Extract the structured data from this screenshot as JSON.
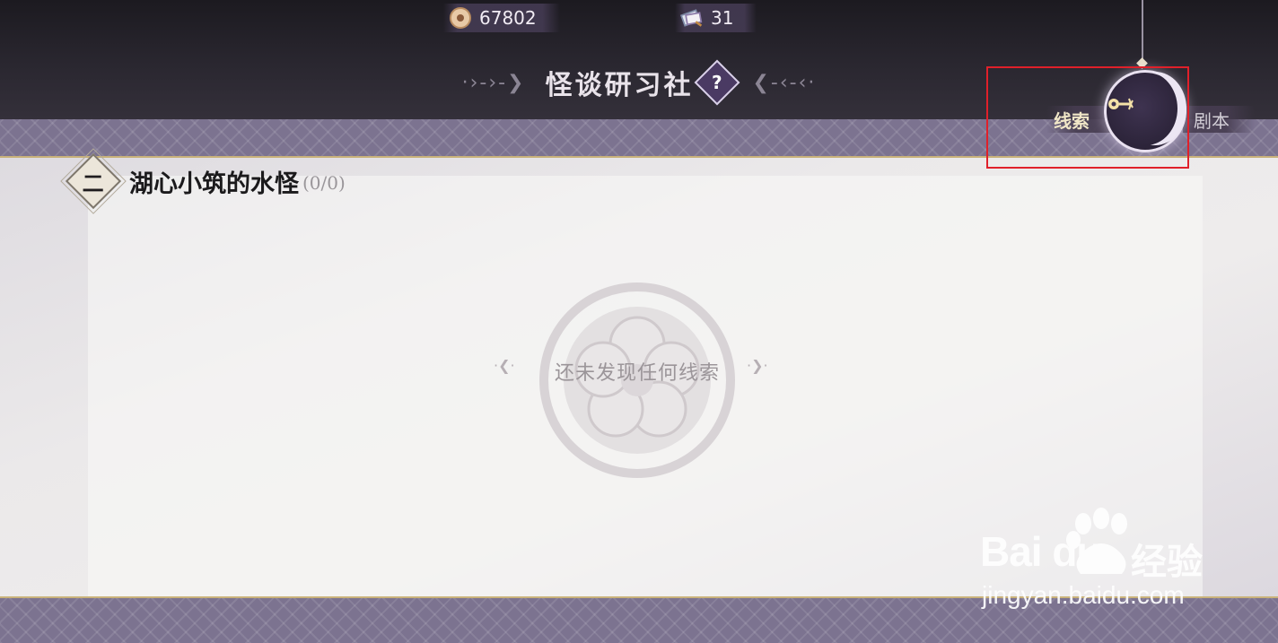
{
  "header": {
    "title": "怪谈研习社",
    "help_label": "?",
    "currencies": [
      {
        "icon": "coin-icon",
        "value": "67802"
      },
      {
        "icon": "scroll-ticket-icon",
        "value": "31"
      }
    ]
  },
  "chapter": {
    "number": "二",
    "title": "湖心小筑的水怪",
    "count": "(0/0)"
  },
  "empty_state": {
    "message": "还未发现任何线索"
  },
  "toggle": {
    "left_label": "线索",
    "right_label": "剧本",
    "selected": "线索"
  },
  "watermark": {
    "logo": "Bai du",
    "brand": "经验",
    "url": "jingyan.baidu.com"
  },
  "colors": {
    "highlight": "#e0202a",
    "accent_gold": "#c9b27a",
    "band": "#7c7390"
  }
}
